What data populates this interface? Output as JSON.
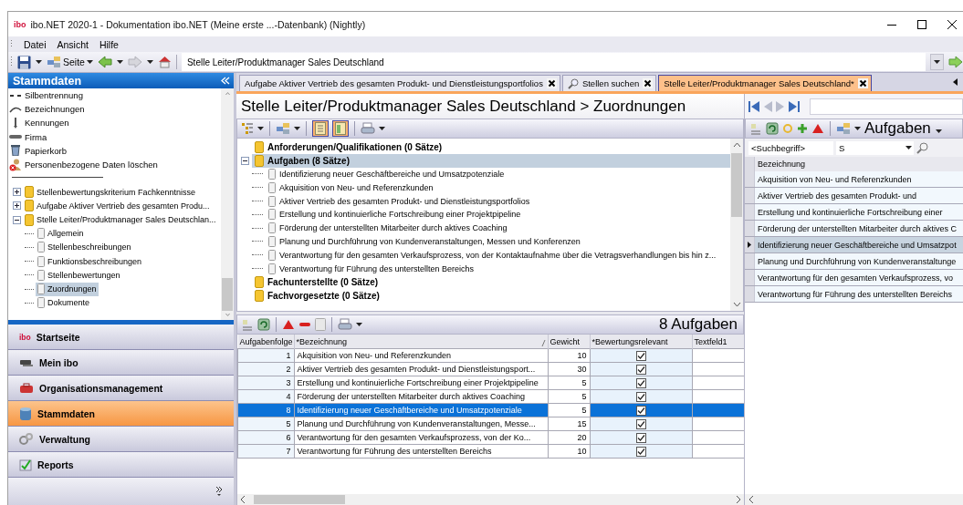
{
  "window": {
    "logo": "ibo",
    "title": "ibo.NET 2020-1 - Dokumentation ibo.NET (Meine erste ...-Datenbank) (Nightly)"
  },
  "menu": [
    {
      "label": "Datei"
    },
    {
      "label": "Ansicht"
    },
    {
      "label": "Hilfe"
    }
  ],
  "toolbar": {
    "page_button": "Seite",
    "address": "Stelle Leiter/Produktmanager Sales Deutschland"
  },
  "sidebar": {
    "title": "Stammdaten",
    "items": [
      {
        "label": "Silbentrennung"
      },
      {
        "label": "Bezeichnungen"
      },
      {
        "label": "Kennungen"
      },
      {
        "label": "Firma"
      },
      {
        "label": "Papierkorb"
      },
      {
        "label": "Personenbezogene Daten löschen"
      }
    ],
    "tree": [
      {
        "label": "Stellenbewertungskriterium Fachkenntnisse",
        "expanded": false,
        "selected": false
      },
      {
        "label": "Aufgabe Aktiver Vertrieb des gesamten Produ...",
        "expanded": false,
        "selected": false
      },
      {
        "label": "Stelle Leiter/Produktmanager Sales Deutschlan...",
        "expanded": true,
        "selected": false,
        "children": [
          {
            "label": "Allgemein",
            "selected": false
          },
          {
            "label": "Stellenbeschreibungen",
            "selected": false
          },
          {
            "label": "Funktionsbeschreibungen",
            "selected": false
          },
          {
            "label": "Stellenbewertungen",
            "selected": false
          },
          {
            "label": "Zuordnungen",
            "selected": true
          },
          {
            "label": "Dokumente",
            "selected": false
          }
        ]
      }
    ],
    "nav": [
      {
        "label": "Startseite",
        "logo": "ibo",
        "selected": false
      },
      {
        "label": "Mein ibo",
        "selected": false
      },
      {
        "label": "Organisationsmanagement",
        "selected": false
      },
      {
        "label": "Stammdaten",
        "selected": true
      },
      {
        "label": "Verwaltung",
        "selected": false
      },
      {
        "label": "Reports",
        "selected": false
      }
    ]
  },
  "tabs": [
    {
      "label": "Aufgabe Aktiver Vertrieb des gesamten Produkt- und Dienstleistungsportfolios",
      "kind": "record",
      "selected": false
    },
    {
      "label": "Stellen suchen",
      "kind": "search",
      "selected": false
    },
    {
      "label": "Stelle Leiter/Produktmanager Sales Deutschland*",
      "kind": "record",
      "selected": true
    }
  ],
  "editor": {
    "title": "Stelle Leiter/Produktmanager Sales Deutschland > Zuordnungen",
    "toolbar_toggles": [
      {
        "on": true
      },
      {
        "on": true
      }
    ],
    "tree": [
      {
        "label": "Anforderungen/Qualifikationen (0 Sätze)",
        "selected": false
      },
      {
        "label": "Aufgaben (8 Sätze)",
        "selected": true,
        "expanded": true,
        "children": [
          {
            "label": "Identifizierung neuer Geschäftbereiche und Umsatzpotenziale",
            "selected": false
          },
          {
            "label": "Akquisition von Neu- und Referenzkunden",
            "selected": false
          },
          {
            "label": "Aktiver Vertrieb des gesamten Produkt- und Dienstleistungsportfolios",
            "selected": false
          },
          {
            "label": "Erstellung und kontinuierliche Fortschreibung einer Projektpipeline",
            "selected": false
          },
          {
            "label": "Förderung der unterstellten Mitarbeiter durch aktives Coaching",
            "selected": false
          },
          {
            "label": "Planung und Durchführung von Kundenveranstaltungen, Messen und Konferenzen",
            "selected": false
          },
          {
            "label": "Verantwortung für den gesamten Verkaufsprozess, von der Kontaktaufnahme über die Vetragsverhandlungen bis hin z...",
            "selected": false
          },
          {
            "label": "Verantwortung für Führung des unterstellten Bereichs",
            "selected": false
          }
        ]
      },
      {
        "label": "Fachunterstellte (0 Sätze)",
        "selected": false
      },
      {
        "label": "Fachvorgesetzte (0 Sätze)",
        "selected": false
      }
    ],
    "table": {
      "title": "8 Aufgaben",
      "columns": [
        "Aufgabenfolge",
        "*Bezeichnung",
        "Gewicht",
        "*Bewertungsrelevant",
        "Textfeld1"
      ],
      "rows": [
        {
          "order": "1",
          "name": "Akquisition von Neu- und Referenzkunden",
          "weight": "10",
          "relevant": true,
          "selected": false
        },
        {
          "order": "2",
          "name": "Aktiver Vertrieb des gesamten Produkt- und Dienstleistungsport...",
          "weight": "30",
          "relevant": true,
          "selected": false
        },
        {
          "order": "3",
          "name": "Erstellung und kontinuierliche Fortschreibung einer Projektpipeline",
          "weight": "5",
          "relevant": true,
          "selected": false
        },
        {
          "order": "4",
          "name": "Förderung der unterstellten Mitarbeiter durch aktives Coaching",
          "weight": "5",
          "relevant": true,
          "selected": false
        },
        {
          "order": "8",
          "name": "Identifizierung neuer Geschäftbereiche und Umsatzpotenziale",
          "weight": "5",
          "relevant": true,
          "selected": true
        },
        {
          "order": "5",
          "name": "Planung und Durchführung von Kundenveranstaltungen, Messe...",
          "weight": "15",
          "relevant": true,
          "selected": false
        },
        {
          "order": "6",
          "name": "Verantwortung für den gesamten Verkaufsprozess, von der Ko...",
          "weight": "20",
          "relevant": true,
          "selected": false
        },
        {
          "order": "7",
          "name": "Verantwortung für Führung des unterstellten Bereichs",
          "weight": "10",
          "relevant": true,
          "selected": false
        }
      ]
    }
  },
  "right_panel": {
    "title": "Aufgaben",
    "search_field": "<Suchbegriff>",
    "search_value": "S",
    "column": "Bezeichnung",
    "rows": [
      {
        "label": "Akquisition von Neu- und Referenzkunden",
        "selected": false
      },
      {
        "label": "Aktiver Vertrieb des gesamten Produkt- und",
        "selected": false
      },
      {
        "label": "Erstellung und kontinuierliche Fortschreibung einer",
        "selected": false
      },
      {
        "label": "Förderung der unterstellten Mitarbeiter durch aktives C",
        "selected": false
      },
      {
        "label": "Identifizierung neuer Geschäftbereiche und Umsatzpot",
        "selected": true
      },
      {
        "label": "Planung und Durchführung von Kundenveranstaltunge",
        "selected": false
      },
      {
        "label": "Verantwortung für den gesamten Verkaufsprozess, vo",
        "selected": false
      },
      {
        "label": "Verantwortung für Führung des unterstellten Bereichs",
        "selected": false
      }
    ]
  }
}
